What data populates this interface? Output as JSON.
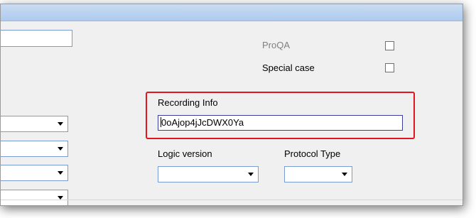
{
  "form": {
    "proqa_label": "ProQA",
    "special_case_label": "Special case",
    "recording_info_label": "Recording Info",
    "recording_info_value": "0oAjop4jJcDWX0Ya",
    "logic_version_label": "Logic version",
    "protocol_type_label": "Protocol Type",
    "logic_version_value": "",
    "protocol_type_value": ""
  },
  "colors": {
    "highlight": "#e0171f",
    "field_border": "#7a9cd3",
    "titlebar": "#aecbee"
  }
}
